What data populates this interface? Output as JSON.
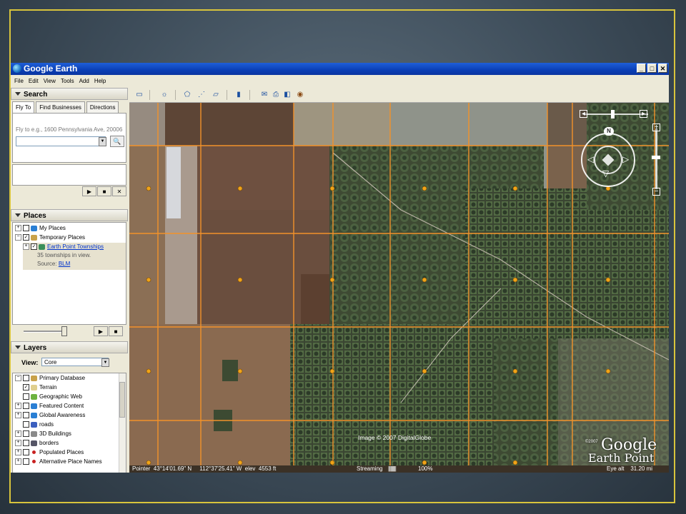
{
  "window": {
    "title": "Google Earth"
  },
  "menu": [
    "File",
    "Edit",
    "View",
    "Tools",
    "Add",
    "Help"
  ],
  "search": {
    "header": "Search",
    "tabs": [
      "Fly To",
      "Find Businesses",
      "Directions"
    ],
    "flyto_hint": "Fly to e.g., 1600 Pennsylvania Ave, 20006",
    "flyto_value": ""
  },
  "places": {
    "header": "Places",
    "items": [
      {
        "label": "My Places"
      },
      {
        "label": "Temporary Places"
      },
      {
        "label": "Earth Point Townships",
        "desc1": "35 townships in view.",
        "source_label": "Source:",
        "source_link": "BLM"
      }
    ]
  },
  "layers": {
    "header": "Layers",
    "view_label": "View:",
    "view_value": "Core",
    "items": [
      "Primary Database",
      "Terrain",
      "Geographic Web",
      "Featured Content",
      "Global Awareness",
      "roads",
      "3D Buildings",
      "borders",
      "Populated Places",
      "Alternative Place Names"
    ]
  },
  "map": {
    "credit": "Image © 2007 DigitalGlobe",
    "logo_copyright": "©2007",
    "logo_google": "Google",
    "logo_earthpoint": "Earth Point",
    "compass_letter": "N"
  },
  "status": {
    "pointer": "Pointer  43°14'01.69\" N     112°37'25.41\" W  elev  4553 ft",
    "streaming_label": "Streaming",
    "streaming_bars": "||||||||||",
    "streaming_pct": "100%",
    "eye_alt": "Eye alt    31.20 mi"
  },
  "colors": {
    "grid": "#f2922a",
    "marker": "#f0a418",
    "titlebar": "#0a3fb5"
  }
}
